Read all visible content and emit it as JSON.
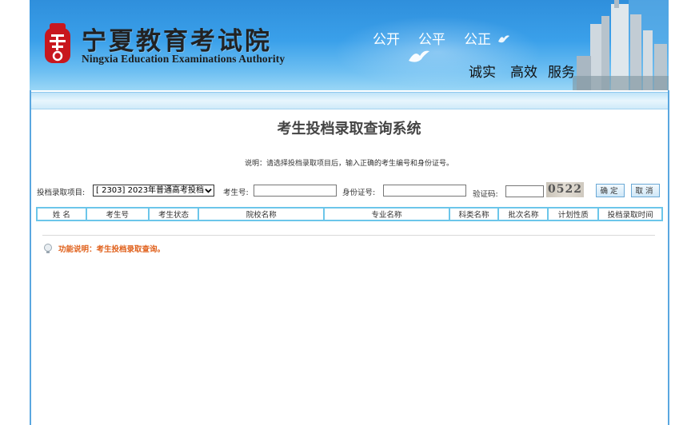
{
  "banner": {
    "org_name_cn": "宁夏教育考试院",
    "org_name_en": "Ningxia Education Examinations Authority",
    "slogan_top": [
      "公开",
      "公平",
      "公正"
    ],
    "slogan_bottom": [
      "诚实",
      "高效",
      "服务"
    ]
  },
  "page": {
    "title": "考生投档录取查询系统",
    "description": "说明：请选择投档录取项目后，输入正确的考生编号和身份证号。"
  },
  "form": {
    "project_label": "投档录取项目:",
    "project_value": "[ 2303] 2023年普通高考投档",
    "exam_no_label": "考生号:",
    "exam_no_value": "",
    "id_label": "身份证号:",
    "id_value": "",
    "captcha_label": "验证码:",
    "captcha_value": "",
    "captcha_image_text": "0522",
    "confirm_label": "确定",
    "cancel_label": "取消"
  },
  "table": {
    "columns": [
      "姓 名",
      "考生号",
      "考生状态",
      "院校名称",
      "专业名称",
      "科类名称",
      "批次名称",
      "计划性质",
      "投档录取时间"
    ]
  },
  "note": {
    "text": "功能说明：考生投档录取查询。"
  },
  "colors": {
    "banner_blue": "#3aa0ea",
    "table_border": "#6cc6ea",
    "note_orange": "#e0611c",
    "seal_red": "#c8171e"
  }
}
